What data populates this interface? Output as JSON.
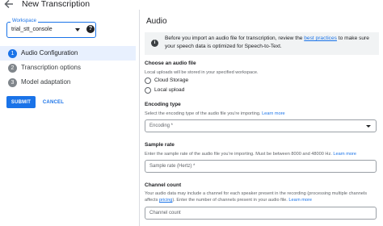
{
  "header": {
    "title": "New Transcription",
    "back_icon": "arrow-back-icon"
  },
  "workspace": {
    "label": "Workspace",
    "value": "trial_stt_console",
    "help_icon_text": "?"
  },
  "steps": [
    {
      "number": "1",
      "label": "Audio Configuration",
      "active": true
    },
    {
      "number": "2",
      "label": "Transcription options",
      "active": false
    },
    {
      "number": "3",
      "label": "Model adaptation",
      "active": false
    }
  ],
  "actions": {
    "submit_label": "SUBMIT",
    "cancel_label": "CANCEL"
  },
  "audio": {
    "title": "Audio",
    "info_icon_text": "i",
    "banner_before": "Before you import an audio file for transcription, review the ",
    "banner_link": "best practices",
    "banner_after": " to make sure your speech data is optimized for Speech-to-Text.",
    "file_section": {
      "label": "Choose an audio file",
      "description": "Local uploads will be stored in your specified workspace.",
      "options": [
        "Cloud Storage",
        "Local upload"
      ]
    },
    "encoding": {
      "label": "Encoding type",
      "description": "Select the encoding type of the audio file you're importing.",
      "learn_more": "Learn more",
      "placeholder": "Encoding *"
    },
    "sample_rate": {
      "label": "Sample rate",
      "description": "Enter the sample rate of the audio file you're importing. Must be between 8000 and 48000 Hz.",
      "learn_more": "Learn more",
      "placeholder": "Sample rate (Hertz) *"
    },
    "channel_count": {
      "label": "Channel count",
      "description_1": "Your audio data may include a channel for each speaker present in the recording (processing multiple channels affects ",
      "description_link": "pricing",
      "description_2": "). Enter the number of channels present in your audio file.",
      "learn_more": "Learn more",
      "placeholder": "Channel count"
    }
  },
  "colors": {
    "accent": "#1a73e8",
    "active_step_bg": "#e8f0fe",
    "banner_bg": "#f1f3f4"
  }
}
